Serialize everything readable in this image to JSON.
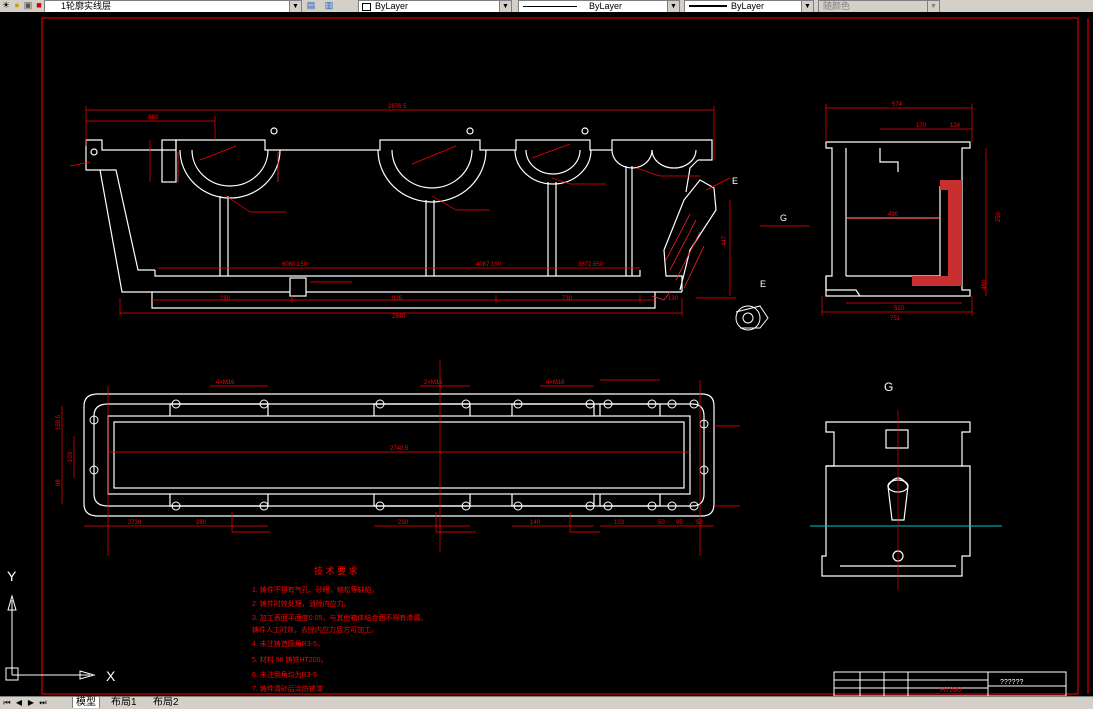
{
  "toolbar": {
    "layer_name": "1轮廓实线层",
    "color_value": "ByLayer",
    "linetype_value": "ByLayer",
    "lineweight_value": "ByLayer",
    "plotstyle_value": "随颜色"
  },
  "drawing": {
    "elevation_view": {
      "overall_width": "2876.5",
      "left_offset": "883",
      "base_length": "2840",
      "base_segments": [
        "280",
        "926",
        "730",
        "130"
      ],
      "dims": [
        "6080.150",
        "4087.100",
        "3672.650",
        "447"
      ],
      "view_label_E": "E",
      "view_label_G": "G",
      "section_E_label": "E"
    },
    "side_view": {
      "top_width": "574",
      "dims": [
        "170",
        "124",
        "490",
        "520",
        "250",
        "751",
        "480"
      ]
    },
    "plan_view": {
      "inner_length": "2740.5",
      "dims_top": [
        "4×M16",
        "2×M16",
        "4×M16"
      ],
      "dims_bottom": [
        "2738",
        "280",
        "230",
        "140",
        "103",
        "50",
        "95",
        "50"
      ],
      "left_dims": [
        "159.5",
        "103",
        "98"
      ]
    },
    "view_G_label": "G",
    "tech_requirements": {
      "title": "技 术 要 求",
      "items": [
        "1. 铸件不得有气孔、砂眼、缩松等缺陷。",
        "2. 铸件时效处理，消除内应力。",
        "3. 加工表面平面度0.05，与其他箱体结合面不得有渗漏。",
        "   铸件人工时效，去除内应力后方可加工。",
        "4. 未注铸造圆角R3-5。",
        "5. 材料 96 铸铁HT200。",
        "6. 未注倒角均为R3-5",
        "7. 铸件清砂后涂防锈漆"
      ]
    },
    "title_block": {
      "material": "HT200",
      "name": "??????"
    },
    "ucs": {
      "x_label": "X",
      "y_label": "Y"
    }
  },
  "tabs": {
    "model": "模型",
    "layout1": "布局1",
    "layout2": "布局2"
  },
  "colors": {
    "geometry": "#ffffff",
    "dimension": "#ff0000",
    "hatch": "#ff2020",
    "cyan_line": "#00c8c8",
    "background": "#000000"
  }
}
